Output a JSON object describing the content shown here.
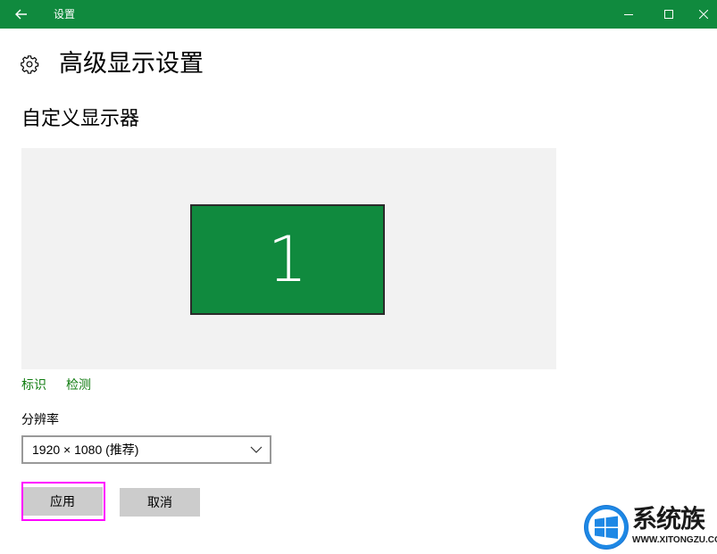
{
  "window": {
    "title": "设置",
    "accent_color": "#108a3e"
  },
  "page": {
    "title": "高级显示设置",
    "section_title": "自定义显示器"
  },
  "display": {
    "monitor_number": "1",
    "monitor_color": "#108a3e",
    "links": {
      "identify": "标识",
      "detect": "检测"
    }
  },
  "resolution": {
    "label": "分辨率",
    "selected": "1920 × 1080 (推荐)"
  },
  "buttons": {
    "apply": "应用",
    "cancel": "取消"
  },
  "watermark": {
    "brand": "系统族",
    "url": "WWW.XITONGZU.COM"
  },
  "icons": [
    "back-arrow-icon",
    "minimize-icon",
    "maximize-icon",
    "close-icon",
    "gear-icon",
    "chevron-down-icon",
    "windows-logo-icon"
  ]
}
